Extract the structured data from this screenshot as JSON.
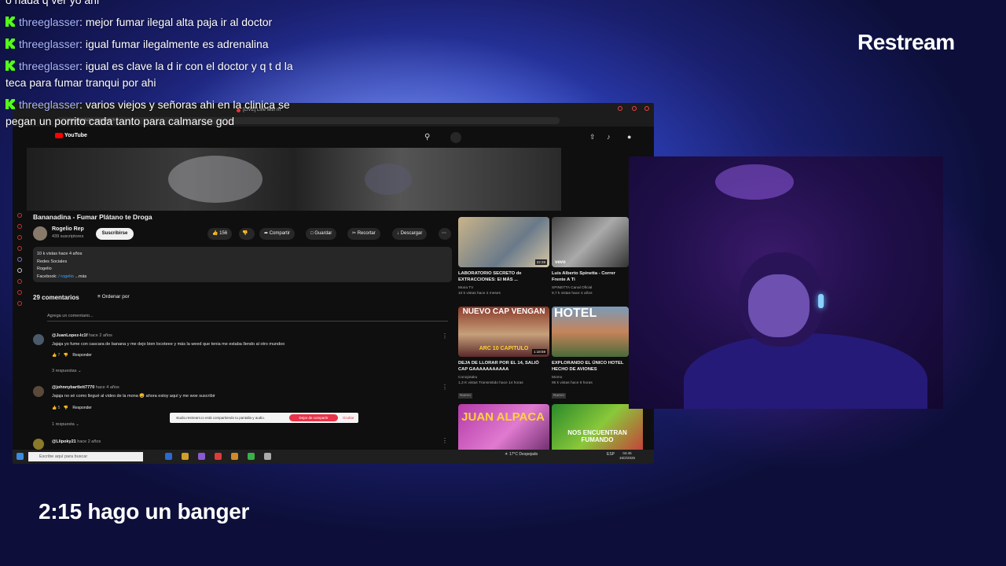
{
  "branding": {
    "logo_text": "Restream"
  },
  "overlay": {
    "caption": "2:15 hago un banger"
  },
  "chat": {
    "platform_icon": "kick-icon",
    "messages": [
      {
        "user": "threeglasser",
        "text": "pero pq infiel en q cambiaria o acerta o nada q ver yo ahi",
        "visible_text": "o nada q ver yo ahi"
      },
      {
        "user": "threeglasser",
        "text": "mejor fumar ilegal alta paja ir al doctor"
      },
      {
        "user": "threeglasser",
        "text": "igual fumar ilegalmente es adrenalina"
      },
      {
        "user": "threeglasser",
        "text": "igual es clave la d ir con el doctor y q t d la teca para fumar tranqui por ahi"
      },
      {
        "user": "threeglasser",
        "text": "varios viejos y señoras ahi en la clinica se pegan un porrito cada tanto para calmarse god"
      }
    ]
  },
  "browser": {
    "tab_label": "[LIVE] Live with m",
    "url": "www.youtube.com/watch"
  },
  "youtube": {
    "logo_text": "YouTube",
    "video_title": "Bananadina - Fumar Plátano te Droga",
    "channel_name": "Rogelio Rep",
    "channel_subs": "439 suscriptores",
    "subscribe_label": "Suscribirse",
    "like_count": "156",
    "actions": {
      "share": "Compartir",
      "save": "Guardar",
      "clip": "Recortar",
      "download": "Descargar"
    },
    "description": {
      "line1": "10 k vistas  hace 4 años",
      "line2": "Redes Sociales",
      "line3": "Rogelio",
      "line4": "Facebook:",
      "facebook_link": "/ rogelio",
      "more": "...más"
    },
    "comments_count": "29 comentarios",
    "sort_label": "Ordenar por",
    "add_comment_placeholder": "Agrega un comentario...",
    "comments": [
      {
        "author": "@JuanLopez-lc1f",
        "time": "hace 2 años",
        "text": "Jajaja yo fume con cascara de banana y me dejo bien locoteee y más la weed que tenia me  estaba llendo al otro mundoo",
        "likes": "7",
        "reply": "Responder",
        "replies": "3 respuestas"
      },
      {
        "author": "@johnnybartlett7770",
        "time": "hace 4 años",
        "text": "Jajaja no sé como llegué al video de la mona 😅 ahora estoy aquí y me woe suscribir",
        "likes": "5",
        "reply": "Responder",
        "replies": "1 respuesta"
      },
      {
        "author": "@Llipoky21",
        "time": "hace 2 años",
        "text": ""
      }
    ],
    "share_notice": "studio.restream.io está compartiendo tu pantalla y audio.",
    "share_stop": "Dejar de compartir",
    "share_hide": "Ocultar",
    "recommendations": [
      {
        "title": "LABORATORIO SECRETO de EXTRACCIONES: El MÁS ...",
        "channel": "Muna TV",
        "meta": "10 k vistas  hace 2 meses",
        "duration": "22:28",
        "thumb_text": ""
      },
      {
        "title": "Luis Alberto Spinetta - Correr Frente A Ti",
        "channel": "SPINETTA Canal Oficial",
        "meta": "9,7 k vistas  hace 4 años",
        "duration": "",
        "thumb_text": "vevo"
      },
      {
        "title": "DEJA DE LLORAR POR EL 14, SALIÓ CAP GAAAAAAAAAAA",
        "channel": "Conojotaku",
        "meta": "1,3 K vistas  Transmitido hace 14 horas",
        "badge": "Nuevo",
        "duration": "1:18:59",
        "thumb_text": "NUEVO CAP VENGAN",
        "thumb_sub": "ARC 10 CAPITULO"
      },
      {
        "title": "EXPLORANDO EL ÚNICO HOTEL HECHO DE AVIONES",
        "channel": "Momo",
        "meta": "95 k vistas  hace 8 horas",
        "badge": "Nuevo",
        "duration": "",
        "thumb_text": "HOTEL"
      },
      {
        "title": "",
        "channel": "",
        "meta": "",
        "duration": "",
        "thumb_text": "JUAN ALPACA"
      },
      {
        "title": "",
        "channel": "",
        "meta": "",
        "duration": "",
        "thumb_text": "NOS ENCUENTRAN FUMANDO"
      }
    ]
  },
  "taskbar": {
    "search_placeholder": "Escribe aquí para buscar",
    "weather": "17°C  Despejado",
    "language": "ESP",
    "time": "04:45",
    "date": "16/2/2026"
  },
  "colors": {
    "kick_green": "#53fc18",
    "chat_username": "#a9b6ff",
    "youtube_red": "#ff0000",
    "share_stop_red": "#e8334a"
  }
}
